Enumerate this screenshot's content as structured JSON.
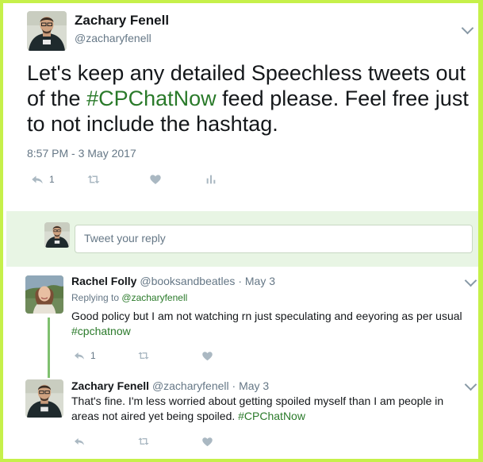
{
  "main_tweet": {
    "author_name": "Zachary Fenell",
    "author_handle": "@zacharyfenell",
    "text_before": "Let's keep any detailed Speechless tweets out of the ",
    "hashtag": "#CPChatNow",
    "text_after": " feed please. Feel free just to not include the hashtag.",
    "timestamp": "8:57 PM - 3 May 2017",
    "reply_count": "1"
  },
  "composer": {
    "placeholder": "Tweet your reply"
  },
  "replies": [
    {
      "author_name": "Rachel Folly",
      "author_handle": "@booksandbeatles",
      "separator": "·",
      "date": "May 3",
      "replying_prefix": "Replying to",
      "replying_to": "@zacharyfenell",
      "text": "Good policy but I am not watching rn just speculating and eeyoring as per usual",
      "hashtag": "#cpchatnow",
      "reply_count": "1"
    },
    {
      "author_name": "Zachary Fenell",
      "author_handle": "@zacharyfenell",
      "separator": "·",
      "date": "May 3",
      "text": "That's fine. I'm less worried about getting spoiled myself than I am people in areas not aired yet being spoiled.",
      "hashtag": "#CPChatNow"
    }
  ],
  "icons": {
    "reply": "reply-icon",
    "retweet": "retweet-icon",
    "like": "heart-icon",
    "analytics": "analytics-icon",
    "menu": "chevron-down-icon"
  },
  "colors": {
    "border": "#c6f04a",
    "hashtag": "#2a7a2a",
    "composer_band": "#e8f5e4",
    "thread_line": "#7fc06f"
  }
}
